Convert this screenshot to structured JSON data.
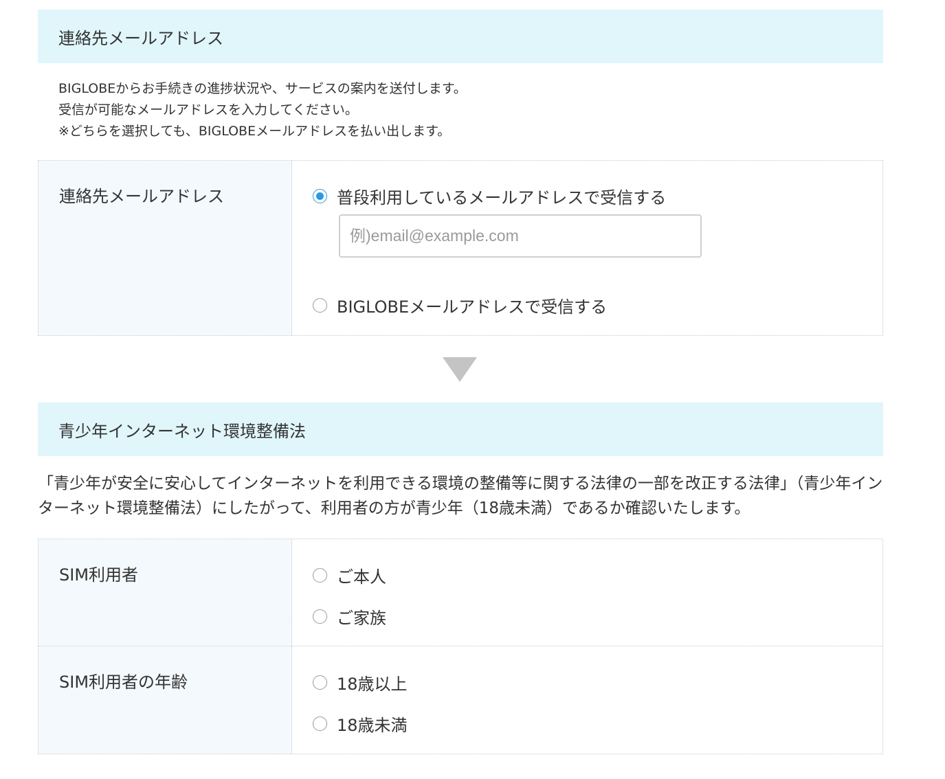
{
  "contact_section": {
    "header": "連絡先メールアドレス",
    "intro_lines": [
      "BIGLOBEからお手続きの進捗状況や、サービスの案内を送付します。",
      "受信が可能なメールアドレスを入力してください。",
      "※どちらを選択しても、BIGLOBEメールアドレスを払い出します。"
    ],
    "field_label": "連絡先メールアドレス",
    "options": [
      {
        "label": "普段利用しているメールアドレスで受信する",
        "checked": true
      },
      {
        "label": "BIGLOBEメールアドレスで受信する",
        "checked": false
      }
    ],
    "email_placeholder": "例)email@example.com",
    "email_value": ""
  },
  "youth_section": {
    "header": "青少年インターネット環境整備法",
    "description": "「青少年が安全に安心してインターネットを利用できる環境の整備等に関する法律の一部を改正する法律」（青少年インターネット環境整備法）にしたがって、利用者の方が青少年（18歳未満）であるか確認いたします。",
    "rows": [
      {
        "label": "SIM利用者",
        "options": [
          {
            "label": "ご本人",
            "checked": false
          },
          {
            "label": "ご家族",
            "checked": false
          }
        ]
      },
      {
        "label": "SIM利用者の年齢",
        "options": [
          {
            "label": "18歳以上",
            "checked": false
          },
          {
            "label": "18歳未満",
            "checked": false
          }
        ]
      }
    ]
  },
  "colors": {
    "section_header_bg": "#e0f6fb",
    "label_cell_bg": "#f4f9fd",
    "radio_checked": "#2b9ae0",
    "arrow": "#c4c4c4"
  },
  "icons": {
    "arrow": "down-triangle-icon",
    "radio": "radio-button-icon"
  }
}
